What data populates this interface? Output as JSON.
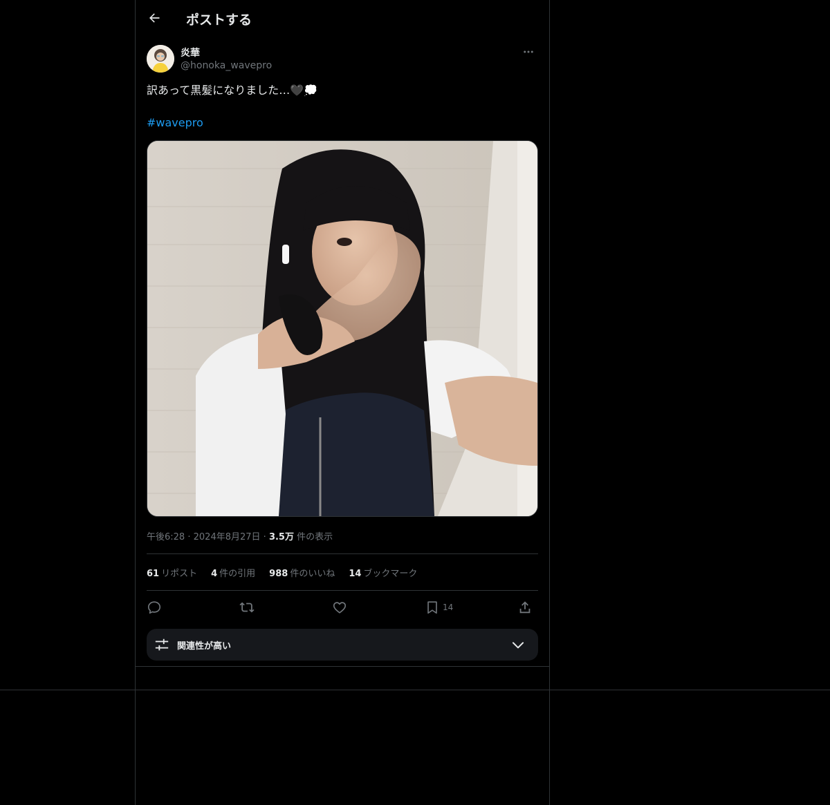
{
  "header": {
    "title": "ポストする",
    "back_icon": "arrow-left-icon"
  },
  "author": {
    "display_name": "炎華",
    "handle": "@honoka_wavepro"
  },
  "post": {
    "text": "訳あって黒髪になりました…🖤💭",
    "hashtag": "#wavepro",
    "media_alt": "long black hair selfie, white t-shirt and black denim overall dress"
  },
  "meta": {
    "time": "午後6:28",
    "separator": "·",
    "date": "2024年8月27日",
    "views_count": "3.5万",
    "views_label": "件の表示"
  },
  "stats": {
    "reposts_count": "61",
    "reposts_label": "リポスト",
    "quotes_count": "4",
    "quotes_label": "件の引用",
    "likes_count": "988",
    "likes_label": "件のいいね",
    "bookmarks_count": "14",
    "bookmarks_label": "ブックマーク"
  },
  "actions": {
    "reply_icon": "reply-icon",
    "repost_icon": "repost-icon",
    "like_icon": "heart-icon",
    "bookmark_icon": "bookmark-icon",
    "bookmark_count": "14",
    "share_icon": "share-icon"
  },
  "sort": {
    "label": "関連性が高い"
  },
  "colors": {
    "background": "#000000",
    "text": "#e7e9ea",
    "secondary_text": "#71767b",
    "link": "#1d9bf0",
    "border": "#2f3336"
  }
}
